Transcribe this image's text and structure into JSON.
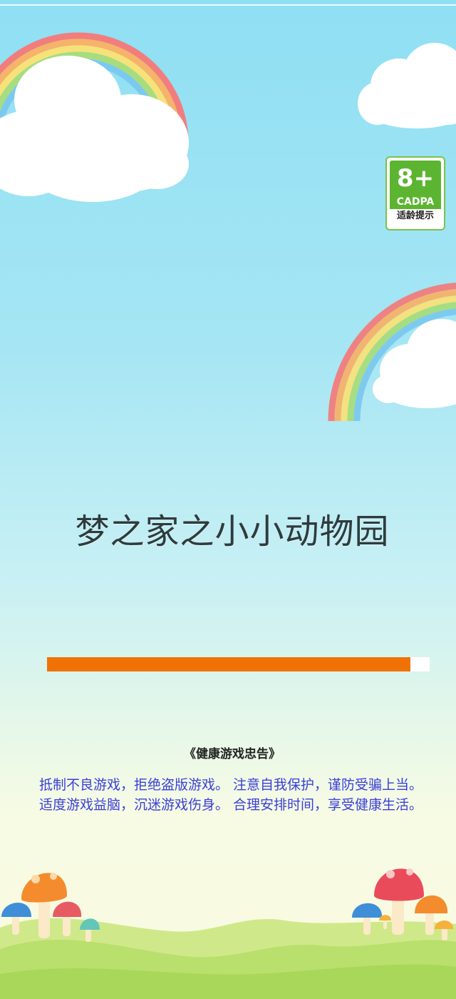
{
  "game_title": "梦之家之小小动物园",
  "age_rating": {
    "age": "8+",
    "org": "CADPA",
    "note": "适龄提示",
    "colors": {
      "green": "#5cb531",
      "border": "#7bc24a"
    }
  },
  "loading": {
    "progress": 0.95,
    "bar_color": "#f07207",
    "track_color": "#ffffff"
  },
  "health_advice": {
    "heading": "《健康游戏忠告》",
    "lines": [
      "抵制不良游戏，拒绝盗版游戏。 注意自我保护，谨防受骗上当。",
      "适度游戏益脑，沉迷游戏伤身。 合理安排时间，享受健康生活。"
    ],
    "text_color": "#3a3fd8"
  }
}
